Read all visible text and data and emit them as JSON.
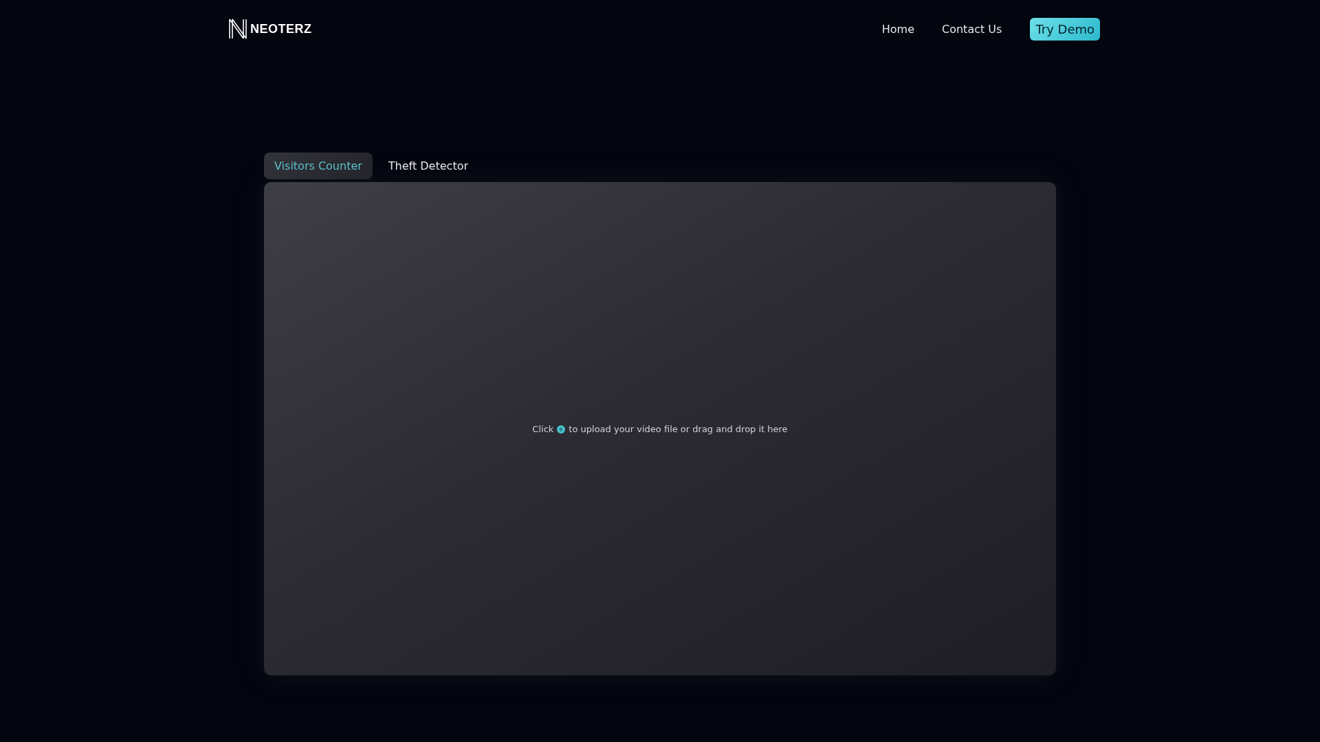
{
  "header": {
    "logo": "NEOTERZ",
    "nav": [
      {
        "label": "Home"
      },
      {
        "label": "Contact Us"
      }
    ],
    "cta": "Try Demo"
  },
  "tabs": [
    {
      "label": "Visitors Counter",
      "selected": true
    },
    {
      "label": "Theft Detector",
      "selected": false
    }
  ],
  "upload": {
    "before": "Click",
    "after": "to upload your video file or drag and drop it here"
  }
}
